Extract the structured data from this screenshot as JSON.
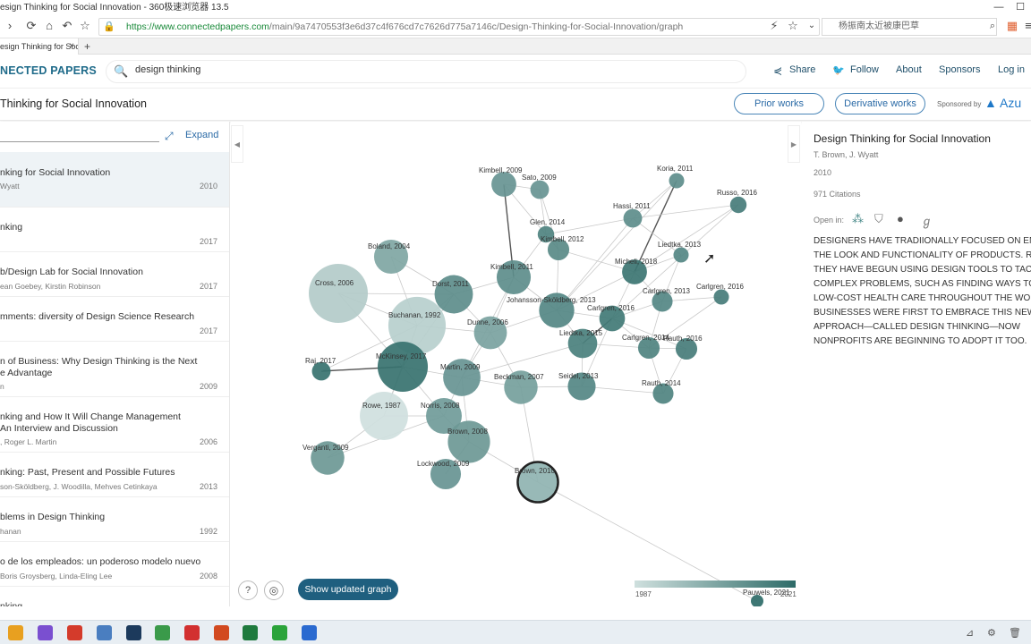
{
  "browser": {
    "window_title": "esign Thinking for Social Innovation - 360极速浏览器 13.5",
    "url_prefix": "https://www.connectedpapers.com",
    "url_rest": "/main/9a7470553f3e6d37c4f676cd7c7626d775a7146c/Design-Thinking-for-Social-Innovation/graph",
    "side_search": "杨振南太近被康巴草",
    "tab_label": "esign Thinking for Social In",
    "tab_close": "×",
    "tab_add": "+",
    "nav_icons": [
      "reload-icon",
      "home-icon",
      "undo-icon",
      "star-icon"
    ],
    "win_min": "—",
    "win_max": "☐"
  },
  "header": {
    "logo": "NECTED PAPERS",
    "search_value": "design thinking",
    "share": "Share",
    "follow": "Follow",
    "about": "About",
    "sponsors": "Sponsors",
    "login": "Log in"
  },
  "titlerow": {
    "title": "Thinking for Social Innovation",
    "prior": "Prior works",
    "derivative": "Derivative works",
    "sponsored": "Sponsored by",
    "azure": "Azu"
  },
  "leftpanel": {
    "expand": "Expand",
    "items": [
      {
        "title": "nking for Social Innovation",
        "authors": "Wyatt",
        "year": "2010"
      },
      {
        "title": "nking",
        "authors": "",
        "year": "2017"
      },
      {
        "title": "b/Design Lab for Social Innovation",
        "authors": "ean Goebey, Kirstin Robinson",
        "year": "2017"
      },
      {
        "title": "mments: diversity of Design Science Research",
        "authors": "",
        "year": "2017"
      },
      {
        "title": "n of Business: Why Design Thinking is the Next",
        "title2": "e Advantage",
        "authors": "n",
        "year": "2009"
      },
      {
        "title": "nking and How It Will Change Management",
        "title2": "An Interview and Discussion",
        "authors": ", Roger L. Martin",
        "year": "2006"
      },
      {
        "title": "nking: Past, Present and Possible Futures",
        "authors": "son-Sköldberg, J. Woodilla, Mehves Cetinkaya",
        "year": "2013"
      },
      {
        "title": "blems in Design Thinking",
        "authors": "hanan",
        "year": "1992"
      },
      {
        "title": "o de los empleados: un poderoso modelo nuevo",
        "authors": "Boris Groysberg, Linda-Eling Lee",
        "year": "2008"
      },
      {
        "title": "nking",
        "authors": "",
        "year": ""
      }
    ]
  },
  "graph": {
    "help": "?",
    "center": "◎",
    "update_btn": "Show updated graph",
    "legend_min": "1987",
    "legend_max": "2021",
    "nodes": [
      {
        "label": "Kimbell, 2009",
        "year": 2009,
        "cit": 160
      },
      {
        "label": "Sato, 2009",
        "year": 2009,
        "cit": 90
      },
      {
        "label": "Koria, 2011",
        "year": 2011,
        "cit": 60
      },
      {
        "label": "Russo, 2016",
        "year": 2016,
        "cit": 70
      },
      {
        "label": "Hassi, 2011",
        "year": 2011,
        "cit": 90
      },
      {
        "label": "Glen, 2014",
        "year": 2014,
        "cit": 70
      },
      {
        "label": "Kimbell, 2012",
        "year": 2012,
        "cit": 120
      },
      {
        "label": "Boland, 2004",
        "year": 2004,
        "cit": 300
      },
      {
        "label": "Liedtka, 2013",
        "year": 2013,
        "cit": 60
      },
      {
        "label": "Micheli, 2018",
        "year": 2018,
        "cit": 160
      },
      {
        "label": "Cross, 2006",
        "year": 1993,
        "cit": 900
      },
      {
        "label": "Kimbell, 2011",
        "year": 2011,
        "cit": 300
      },
      {
        "label": "Dorst, 2011",
        "year": 2011,
        "cit": 380
      },
      {
        "label": "Carlgren, 2016",
        "year": 2016,
        "cit": 60
      },
      {
        "label": "Carlgren, 2013",
        "year": 2013,
        "cit": 110
      },
      {
        "label": "Johansson-Sköldberg, 2013",
        "year": 2013,
        "cit": 320
      },
      {
        "label": "Carlgren, 2016",
        "year": 2017,
        "cit": 170
      },
      {
        "label": "Buchanan, 1992",
        "year": 1992,
        "cit": 850
      },
      {
        "label": "Dunne, 2006",
        "year": 2005,
        "cit": 280
      },
      {
        "label": "Liedtka, 2015",
        "year": 2015,
        "cit": 220
      },
      {
        "label": "Carlgren, 2014",
        "year": 2014,
        "cit": 120
      },
      {
        "label": "Rauth, 2016",
        "year": 2016,
        "cit": 120
      },
      {
        "label": "Raj, 2017",
        "year": 2019,
        "cit": 90
      },
      {
        "label": "McKinsey, 2017",
        "year": 2019,
        "cit": 650
      },
      {
        "label": "Martin, 2009",
        "year": 2009,
        "cit": 360
      },
      {
        "label": "Beckman, 2007",
        "year": 2006,
        "cit": 290
      },
      {
        "label": "Seidel, 2013",
        "year": 2013,
        "cit": 200
      },
      {
        "label": "Rauth, 2014",
        "year": 2014,
        "cit": 110
      },
      {
        "label": "Rowe, 1987",
        "year": 1987,
        "cit": 600
      },
      {
        "label": "Norris, 2008",
        "year": 2007,
        "cit": 330
      },
      {
        "label": "Brown, 2008",
        "year": 2008,
        "cit": 460
      },
      {
        "label": "Verganti, 2009",
        "year": 2008,
        "cit": 290
      },
      {
        "label": "Lockwood, 2009",
        "year": 2009,
        "cit": 240
      },
      {
        "label": "Brown, 2010",
        "year": 2010,
        "cit": 420
      },
      {
        "label": "Pauwels, 2021",
        "year": 2021,
        "cit": 30
      }
    ]
  },
  "rightpanel": {
    "title": "Design Thinking for Social Innovation",
    "authors": "T. Brown, J. Wyatt",
    "year": "2010",
    "citations": "971 Citations",
    "open_in": "Open in:",
    "open_icons": [
      "connected-icon",
      "semantic-scholar-icon",
      "doi-icon",
      "google-scholar-icon"
    ],
    "abstract": "DESIGNERS HAVE TRADIIONALLY FOCUSED ON EN\nTHE LOOK AND FUNCTIONALITY OF PRODUCTS. RE\nTHEY HAVE BEGUN USING DESIGN TOOLS TO TACK\nCOMPLEX PROBLEMS, SUCH AS FINDING WAYS TO\nLOW-COST HEALTH CARE THROUGHOUT THE WOR\nBUSINESSES WERE FIRST TO EMBRACE THIS NEW\nAPPROACH—CALLED DESIGN THINKING—NOW\nNONPROFITS ARE BEGINNING TO ADOPT IT TOO."
  },
  "taskbar": {
    "apps": [
      {
        "name": "file-explorer-icon",
        "color": "#e8a020"
      },
      {
        "name": "browser-360-icon",
        "color": "#7a4fd0"
      },
      {
        "name": "app-red-icon",
        "color": "#d43b2b"
      },
      {
        "name": "app-blue-icon",
        "color": "#4a7ec0"
      },
      {
        "name": "photoshop-icon",
        "color": "#1c3a5c"
      },
      {
        "name": "chrome-icon",
        "color": "#3a9a4a"
      },
      {
        "name": "wps-icon",
        "color": "#d23030"
      },
      {
        "name": "powerpoint-icon",
        "color": "#d24a20"
      },
      {
        "name": "excel-icon",
        "color": "#1e7a3e"
      },
      {
        "name": "wechat-icon",
        "color": "#2aa33a"
      },
      {
        "name": "app-blue2-icon",
        "color": "#2a6ad0"
      }
    ],
    "tray_icons": [
      "pin-icon",
      "settings-icon",
      "trash-icon",
      "expand-icon"
    ]
  }
}
